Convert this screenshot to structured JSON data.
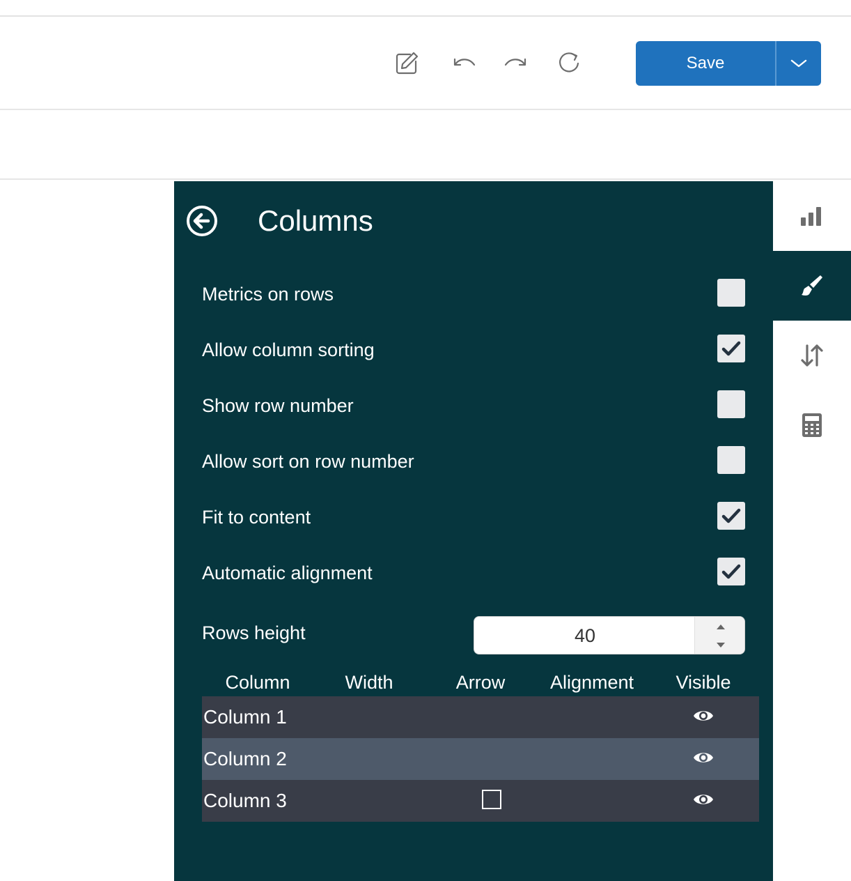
{
  "toolbar": {
    "save_label": "Save",
    "icons": [
      "edit-icon",
      "undo-icon",
      "redo-icon",
      "refresh-icon",
      "chevron-down-icon"
    ]
  },
  "panel": {
    "title": "Columns",
    "background": "#06363e",
    "options": [
      {
        "label": "Metrics on rows",
        "checked": false
      },
      {
        "label": "Allow column sorting",
        "checked": true
      },
      {
        "label": "Show row number",
        "checked": false
      },
      {
        "label": "Allow sort on row number",
        "checked": false
      },
      {
        "label": "Fit to content",
        "checked": true
      },
      {
        "label": "Automatic alignment",
        "checked": true
      }
    ],
    "rows_height": {
      "label": "Rows height",
      "value": "40"
    },
    "table": {
      "headers": [
        "Column",
        "Width",
        "Arrow",
        "Alignment",
        "Visible"
      ],
      "rows": [
        {
          "label": "Column 1",
          "arrow_checkbox": false,
          "visible": true
        },
        {
          "label": "Column 2",
          "arrow_checkbox": false,
          "visible": true
        },
        {
          "label": "Column 3",
          "arrow_checkbox": true,
          "visible": true
        }
      ]
    }
  },
  "sidebar": {
    "tabs": [
      {
        "icon": "bar-chart-icon",
        "active": false
      },
      {
        "icon": "paintbrush-icon",
        "active": true
      },
      {
        "icon": "sort-icon",
        "active": false
      },
      {
        "icon": "calculator-icon",
        "active": false
      }
    ]
  },
  "colors": {
    "accent": "#1f72bd",
    "panel": "#06363e",
    "row_dark": "#393d48",
    "row_light": "#4e5a6a"
  }
}
